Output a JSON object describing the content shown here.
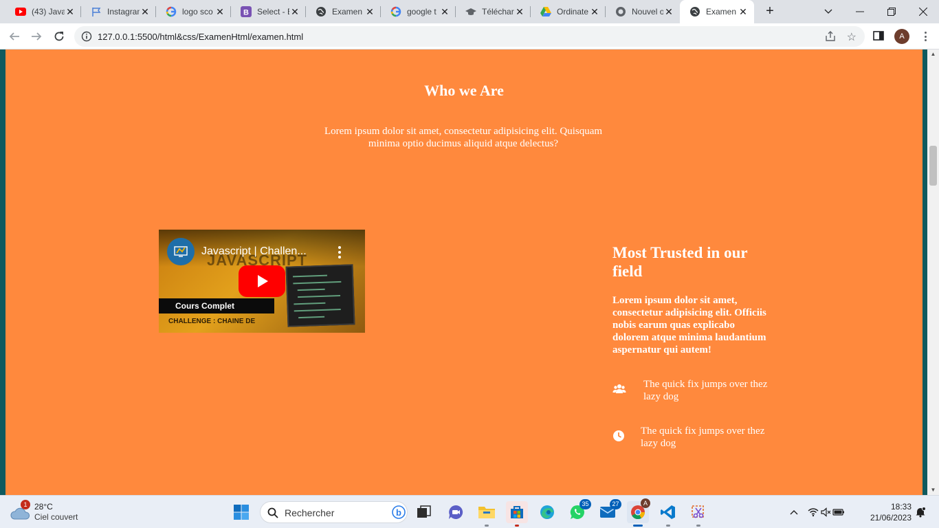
{
  "browser": {
    "tabs": [
      {
        "title": "(43) Java",
        "icon": "youtube-icon"
      },
      {
        "title": "Instagram",
        "icon": "flag-icon"
      },
      {
        "title": "logo sco",
        "icon": "google-icon"
      },
      {
        "title": "Select - E",
        "icon": "bootstrap-icon"
      },
      {
        "title": "Examen",
        "icon": "globe-icon"
      },
      {
        "title": "google t",
        "icon": "google-icon"
      },
      {
        "title": "Téléchar",
        "icon": "graduation-cap-icon"
      },
      {
        "title": "Ordinate",
        "icon": "google-drive-icon"
      },
      {
        "title": "Nouvel o",
        "icon": "github-icon"
      },
      {
        "title": "Examen",
        "icon": "globe-icon"
      }
    ],
    "url": "127.0.0.1:5500/html&css/ExamenHtml/examen.html",
    "profile_initial": "A"
  },
  "page": {
    "who_title": "Who we Are",
    "who_text": "Lorem ipsum dolor sit amet, consectetur adipisicing elit. Quisquam minima optio ducimus aliquid atque delectus?",
    "video": {
      "title": "Javascript | Challen...",
      "thumb_big_text": "JAVASCRIPT",
      "thumb_course": "Cours Complet",
      "thumb_challenge": "CHALLENGE : CHAINE DE"
    },
    "trusted_title": "Most Trusted in our field",
    "trusted_text": "Lorem ipsum dolor sit amet, consectetur adipisicing elit. Officiis nobis earum quas explicabo dolorem atque minima laudantium aspernatur qui autem!",
    "features": [
      {
        "icon": "users-icon",
        "text": "The quick fix jumps over thez lazy dog"
      },
      {
        "icon": "clock-icon",
        "text": "The quick fix jumps over thez lazy dog"
      }
    ]
  },
  "taskbar": {
    "weather_temp": "28°C",
    "weather_cond": "Ciel couvert",
    "weather_badge": "1",
    "search_label": "Rechercher",
    "whatsapp_count": "35",
    "mail_count": "27",
    "chrome_profile": "A",
    "time": "18:33",
    "date": "21/06/2023"
  },
  "colors": {
    "page_bg": "#ff893d",
    "side_bg": "#0f5a5e",
    "youtube_red": "#ff0000",
    "accent": "#005fb8"
  }
}
